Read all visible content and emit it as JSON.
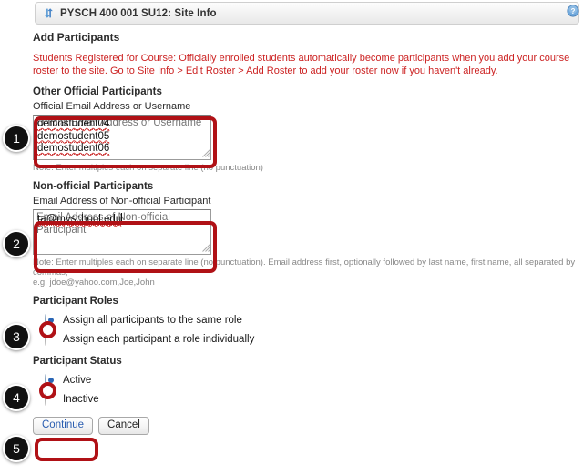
{
  "window": {
    "title": "PYSCH 400 001 SU12: Site Info",
    "title_icon": "swap-arrows-icon",
    "help_icon": "help-question-icon"
  },
  "page": {
    "heading": "Add Participants",
    "warning_label": "Students Registered for Course:",
    "warning_text": " Officially enrolled students automatically become participants when you add your course roster to the site. Go to Site Info > Edit Roster > Add Roster to add your roster now if you haven't already."
  },
  "official": {
    "section_heading": "Other Official Participants",
    "field_label": "Official Email Address or Username",
    "value": "demostudent04\ndemostudent05\ndemostudent06",
    "lines": [
      "demostudent04",
      "demostudent05",
      "demostudent06"
    ],
    "note": "Note: Enter multiples each on separate line (no punctuation)"
  },
  "nonofficial": {
    "section_heading": "Non-official Participants",
    "field_label": "Email Address of Non-official Participant",
    "value": "ta@myschool.edu",
    "note_line1": "Note: Enter multiples each on separate line (no punctuation). Email address first, optionally followed by last name, first name, all separated by commas,",
    "note_line2": "e.g. jdoe@yahoo.com,Joe,John"
  },
  "roles": {
    "heading": "Participant Roles",
    "options": [
      {
        "label": "Assign all participants to the same role",
        "selected": true
      },
      {
        "label": "Assign each participant a role individually",
        "selected": false
      }
    ]
  },
  "status": {
    "heading": "Participant Status",
    "options": [
      {
        "label": "Active",
        "selected": true
      },
      {
        "label": "Inactive",
        "selected": false
      }
    ]
  },
  "actions": {
    "continue_label": "Continue",
    "cancel_label": "Cancel"
  },
  "markers": [
    {
      "number": "1"
    },
    {
      "number": "2"
    },
    {
      "number": "3"
    },
    {
      "number": "4"
    },
    {
      "number": "5"
    }
  ],
  "colors": {
    "annotation_red": "#b01116",
    "warning_red": "#cc2222",
    "link_blue": "#2a5db0",
    "marker_black": "#111111"
  }
}
